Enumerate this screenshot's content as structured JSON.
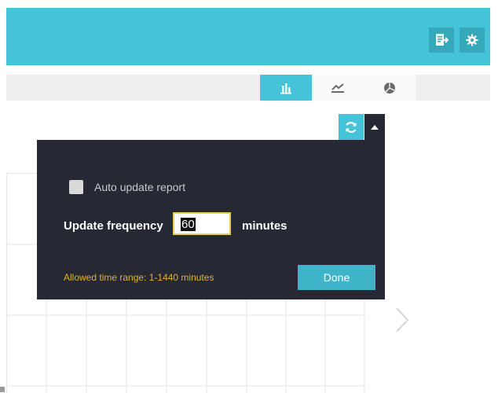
{
  "header": {
    "export_icon": "export-report-icon",
    "settings_icon": "gear-icon"
  },
  "chart_tabs": [
    {
      "icon": "bar-chart-icon",
      "active": true
    },
    {
      "icon": "line-chart-icon",
      "active": false
    },
    {
      "icon": "pie-chart-icon",
      "active": false
    }
  ],
  "toolbar": {
    "refresh_icon": "refresh-icon",
    "dropdown_icon": "caret-up-icon"
  },
  "popup": {
    "auto_update_label": "Auto update report",
    "auto_update_checked": false,
    "frequency_label": "Update frequency",
    "frequency_value": "60",
    "unit_label": "minutes",
    "range_note": "Allowed time range: 1-1440 minutes",
    "done_label": "Done"
  },
  "navigation": {
    "next_icon": "chevron-right-icon"
  },
  "colors": {
    "accent": "#45c4d9",
    "popup_bg": "#262834",
    "warning_text": "#e3b321",
    "input_border": "#e8d04a"
  }
}
